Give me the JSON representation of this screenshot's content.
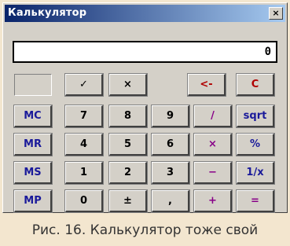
{
  "window": {
    "title": "Калькулятор",
    "close_label": "×"
  },
  "display": {
    "value": "0"
  },
  "buttons": {
    "blank": "",
    "ok": "✓",
    "cancel": "×",
    "backspace": "<-",
    "clear": "C",
    "mc": "MC",
    "mr": "MR",
    "ms": "MS",
    "mp": "MP",
    "n7": "7",
    "n8": "8",
    "n9": "9",
    "n4": "4",
    "n5": "5",
    "n6": "6",
    "n1": "1",
    "n2": "2",
    "n3": "3",
    "n0": "0",
    "plusminus": "±",
    "comma": ",",
    "div": "/",
    "mul": "×",
    "minus": "−",
    "plus": "+",
    "sqrt": "sqrt",
    "percent": "%",
    "inverse": "1/x",
    "equals": "="
  },
  "caption": "Рис. 16. Калькулятор тоже свой",
  "colors": {
    "memory": "#1a1a9a",
    "digits": "#000000",
    "operators": "#880088",
    "edit": "#b00000",
    "background": "#f3e6cf"
  }
}
